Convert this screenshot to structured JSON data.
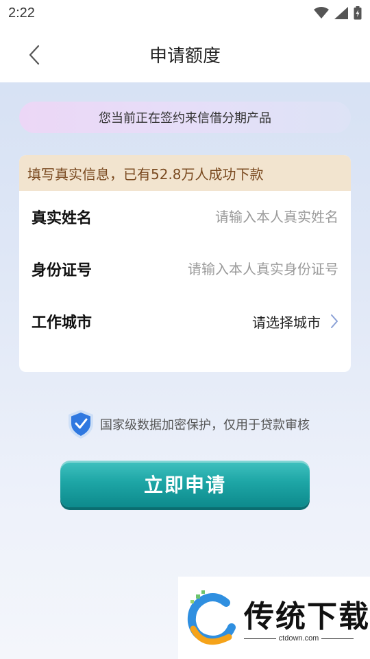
{
  "status_bar": {
    "time": "2:22",
    "icons": [
      "wifi-icon",
      "signal-icon",
      "battery-charging-icon"
    ]
  },
  "header": {
    "back_icon": "chevron-left-icon",
    "title": "申请额度"
  },
  "notice": {
    "text": "您当前正在签约来信借分期产品"
  },
  "form": {
    "banner": "填写真实信息，已有52.8万人成功下款",
    "name_label": "真实姓名",
    "name_placeholder": "请输入本人真实姓名",
    "name_value": "",
    "id_label": "身份证号",
    "id_placeholder": "请输入本人真实身份证号",
    "id_value": "",
    "city_label": "工作城市",
    "city_value": "请选择城市"
  },
  "security": {
    "icon": "shield-check-icon",
    "text": "国家级数据加密保护，仅用于贷款审核"
  },
  "apply_button": {
    "label": "立即申请"
  },
  "watermark": {
    "title": "传统下载",
    "url": "ctdown.com"
  },
  "colors": {
    "accent": "#1ea6a6",
    "banner_bg": "#f2e4cf",
    "banner_text": "#7a4a20",
    "notice_bg": "#e6def8"
  }
}
